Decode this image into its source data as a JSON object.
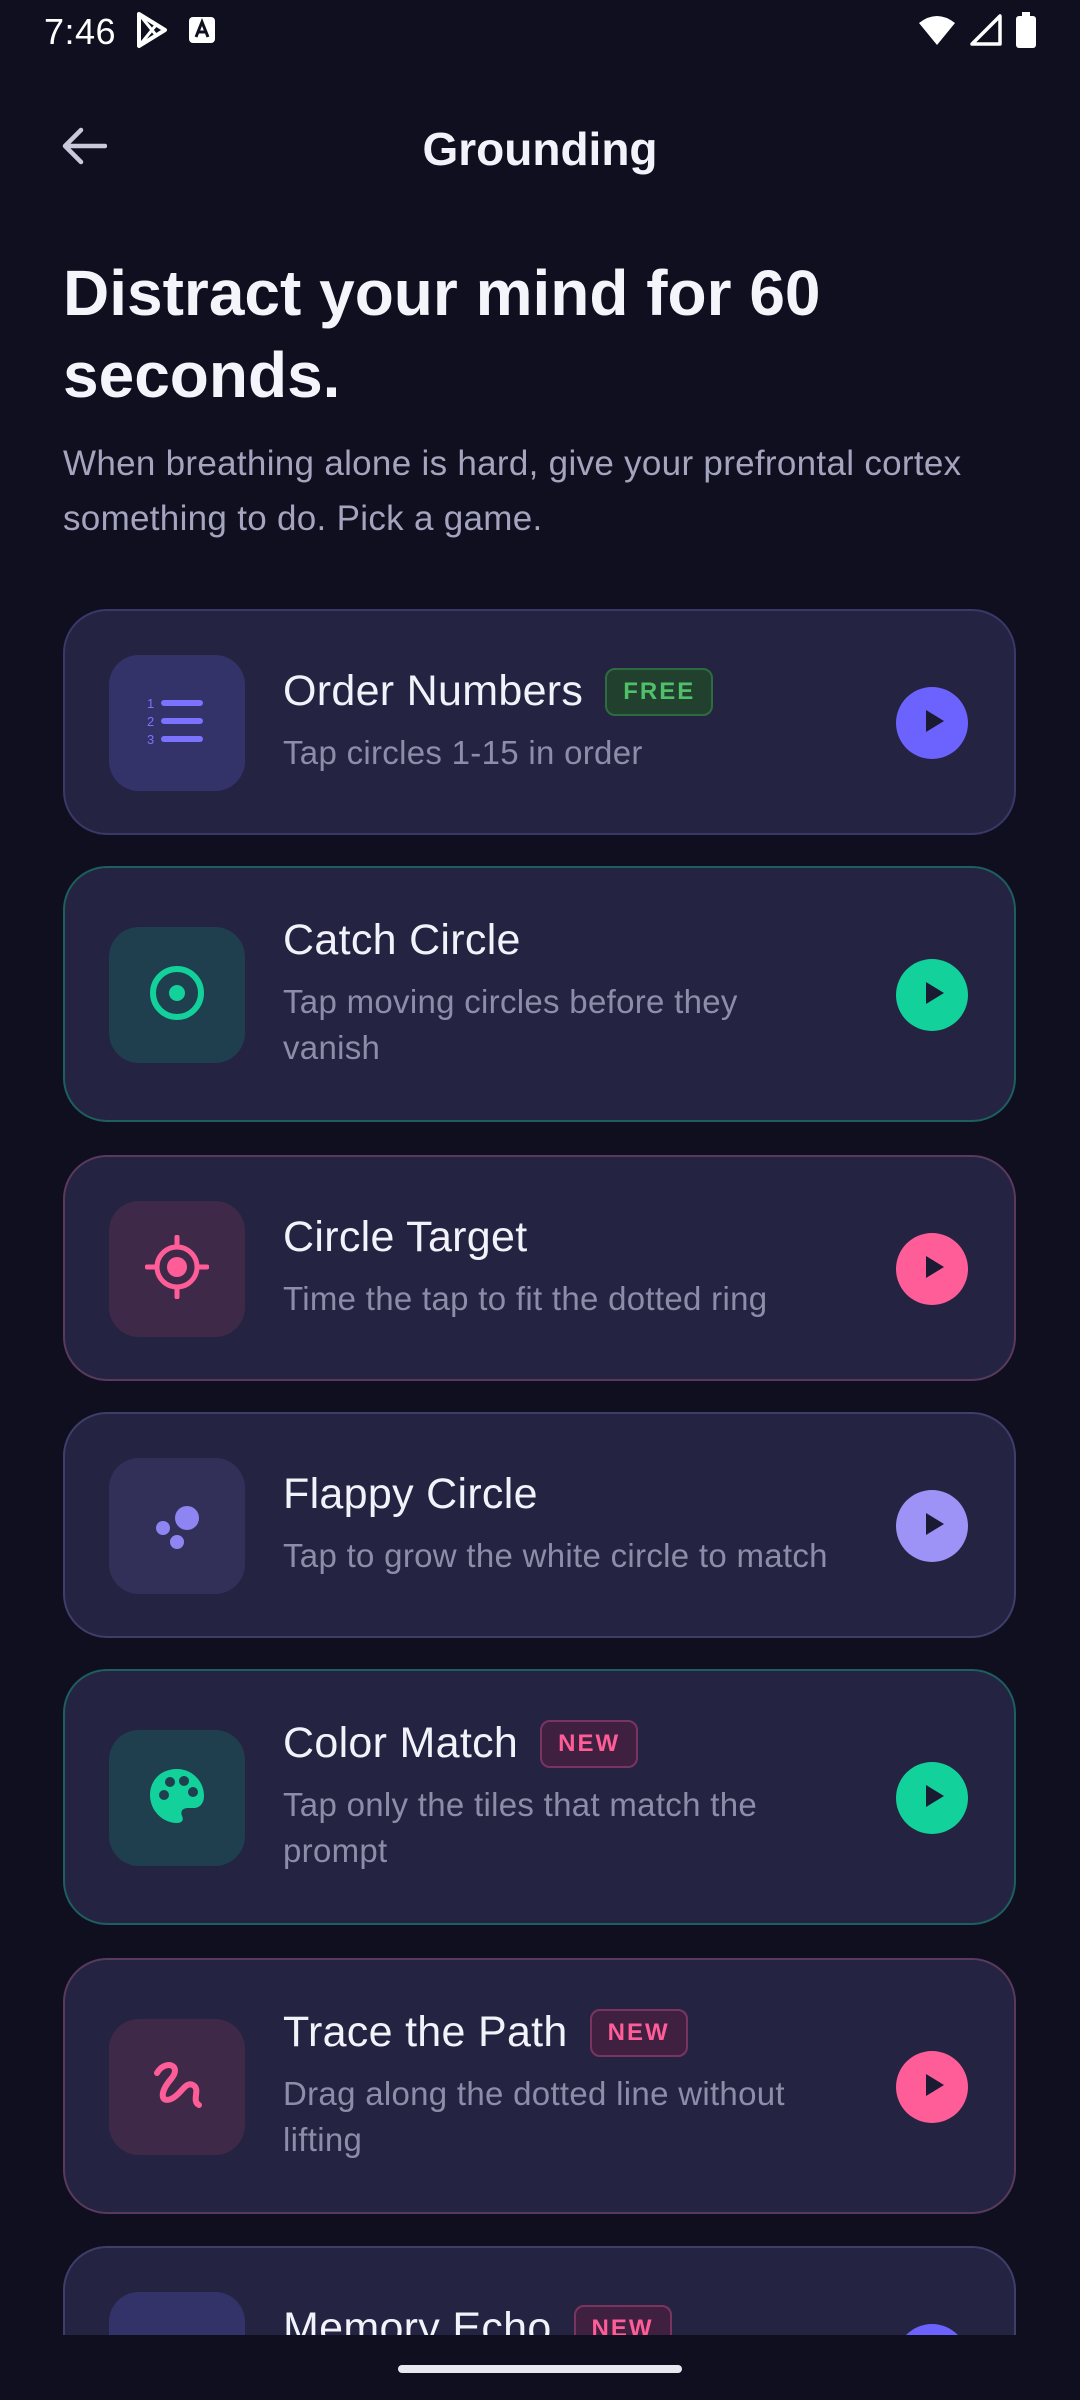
{
  "status_bar": {
    "time": "7:46"
  },
  "header": {
    "title": "Grounding"
  },
  "intro": {
    "headline": "Distract your mind for 60 seconds.",
    "subtitle": "When breathing alone is hard, give your prefrontal cortex something to do. Pick a game."
  },
  "games": [
    {
      "title": "Order Numbers",
      "badge": "FREE",
      "description": "Tap circles 1-15 in order",
      "icon": "numbered-list-icon",
      "accent": "#6c63ff"
    },
    {
      "title": "Catch Circle",
      "badge": "",
      "description": "Tap moving circles before they vanish",
      "icon": "target-dot-icon",
      "accent": "#13d19a"
    },
    {
      "title": "Circle Target",
      "badge": "",
      "description": "Time the tap to fit the dotted ring",
      "icon": "crosshair-icon",
      "accent": "#ff5d98"
    },
    {
      "title": "Flappy Circle",
      "badge": "",
      "description": "Tap to grow the white circle to match",
      "icon": "bubbles-icon",
      "accent": "#9d92f5"
    },
    {
      "title": "Color Match",
      "badge": "NEW",
      "description": "Tap only the tiles that match the prompt",
      "icon": "palette-icon",
      "accent": "#13d19a"
    },
    {
      "title": "Trace the Path",
      "badge": "NEW",
      "description": "Drag along the dotted line without lifting",
      "icon": "squiggle-path-icon",
      "accent": "#ff5d98"
    },
    {
      "title": "Memory Echo",
      "badge": "NEW",
      "description": "",
      "icon": "plus-icon",
      "accent": "#6c63ff"
    }
  ]
}
